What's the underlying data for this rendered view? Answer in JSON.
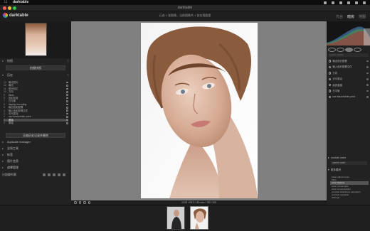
{
  "menubar": {
    "app_name": "darktable"
  },
  "window": {
    "title": "darktable"
  },
  "header": {
    "app_name": "darktable",
    "breadcrumbs": "已选 1 张图像，当前图像共 1 张在视图里",
    "views": [
      "光台",
      "暗房",
      "地图"
    ]
  },
  "left_panel": {
    "sections": {
      "snapshots": "快照",
      "take_snapshot": "拍摄快照",
      "history": "历史",
      "compress_button": "压缩历史记录并删除",
      "duplicate_manager": "duplicate manager",
      "color_picker": "全局工具",
      "tagging": "标签",
      "image_info": "图片信息",
      "mask_manager": "遮罩管理",
      "export_label": "已加载列表"
    },
    "history_items": [
      {
        "num": "13",
        "label": "曝光镜头"
      },
      {
        "num": "12",
        "label": "曝光"
      },
      {
        "num": "11",
        "label": "镜头校正"
      },
      {
        "num": "10",
        "label": "方向"
      },
      {
        "num": "9",
        "label": "filmic"
      },
      {
        "num": "8",
        "label": "色彩校准"
      },
      {
        "num": "7",
        "label": "白平衡"
      },
      {
        "num": "6",
        "label": "display encoding"
      },
      {
        "num": "5",
        "label": "输出色彩配置"
      },
      {
        "num": "4",
        "label": "输入色彩配置文件"
      },
      {
        "num": "3",
        "label": "去马赛克"
      },
      {
        "num": "2",
        "label": "raw black/white point"
      },
      {
        "num": "1",
        "label": "原始"
      },
      {
        "num": "0",
        "label": "原始"
      }
    ]
  },
  "center": {
    "status": "1/1/8 • f/6.3 • 80 mm • ISO 100"
  },
  "right_panel": {
    "search_placeholder": "search module",
    "modules": [
      {
        "label": "输出色彩配置"
      },
      {
        "label": "输入色彩配置文件"
      },
      {
        "label": "方向"
      },
      {
        "label": "去马赛克"
      },
      {
        "label": "高亮重建"
      },
      {
        "label": "白平衡"
      },
      {
        "label": "raw black/white point"
      }
    ],
    "module_order_label": "module order",
    "module_order_value": "current order",
    "presets_label": "更多模块",
    "style_list": [
      {
        "label": "basic adjustments"
      },
      {
        "label": "blurs"
      },
      {
        "label": "color balance"
      },
      {
        "label": "color mix as rgbe"
      },
      {
        "label": "color reconstruction"
      },
      {
        "label": "contrast brightness saturation"
      },
      {
        "label": "contrast equalizer"
      },
      {
        "label": "defringe"
      }
    ],
    "selected_style_index": 2
  },
  "filmstrip": {}
}
